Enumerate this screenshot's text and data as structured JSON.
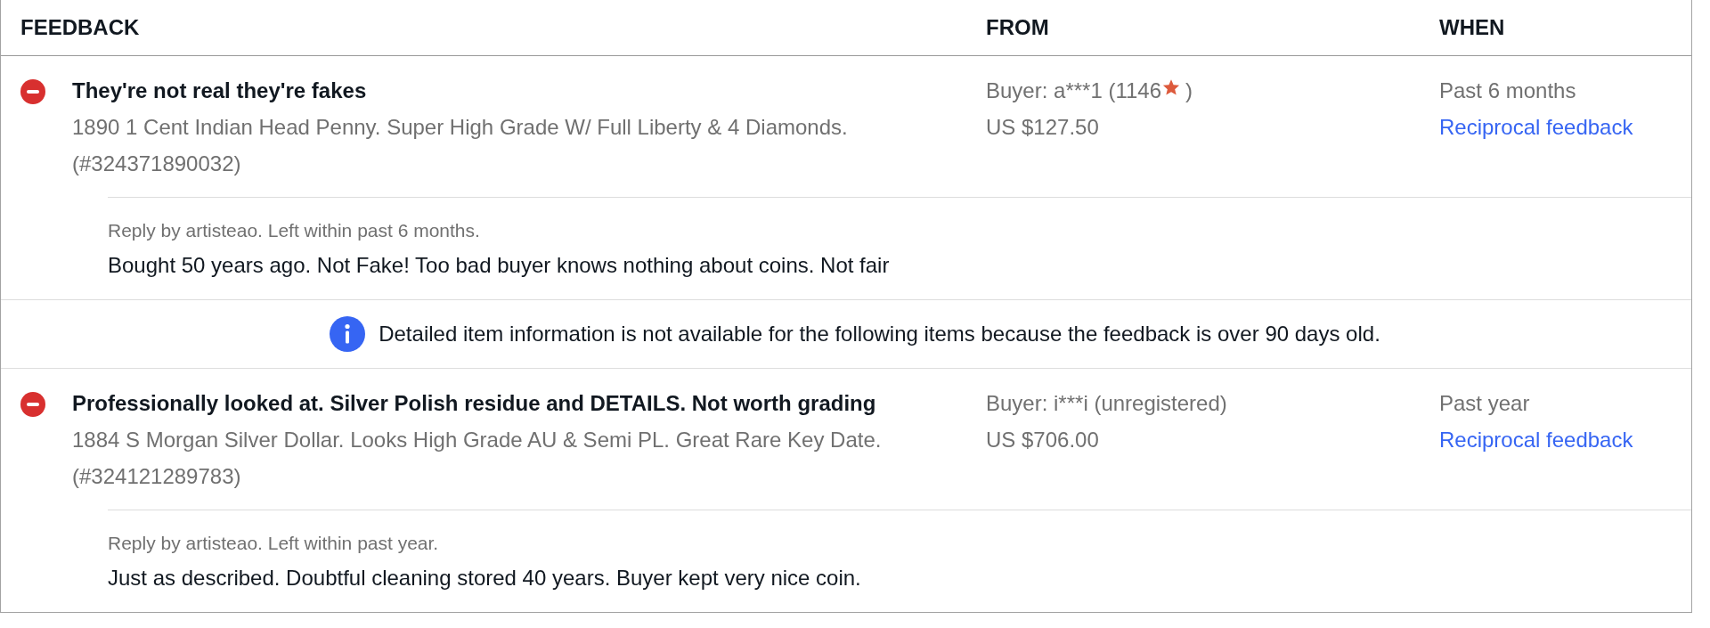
{
  "table": {
    "columns": [
      "FEEDBACK",
      "FROM",
      "WHEN"
    ],
    "rows": [
      {
        "kind": "feedback",
        "negative": true,
        "comment": "They're not real they're fakes",
        "item": "1890 1 Cent Indian Head Penny. Super High Grade W/ Full Liberty & 4 Diamonds. (#324371890032)",
        "buyer": "Buyer: a***1 (1146",
        "star": true,
        "buyer_suffix": ")",
        "price": "US $127.50",
        "when": "Past 6 months",
        "link": "Reciprocal feedback",
        "reply": {
          "meta": "Reply by artisteao. Left within past 6 months.",
          "text": "Bought 50 years ago. Not Fake! Too bad buyer knows nothing about coins. Not fair"
        }
      },
      {
        "kind": "notice",
        "text": "Detailed item information is not available for the following items because the feedback is over 90 days old."
      },
      {
        "kind": "feedback",
        "negative": true,
        "comment": "Professionally looked at. Silver Polish residue and DETAILS. Not worth grading",
        "item": "1884 S Morgan Silver Dollar. Looks High Grade AU & Semi PL. Great Rare Key Date. (#324121289783)",
        "buyer": "Buyer: i***i (unregistered)",
        "star": false,
        "price": "US $706.00",
        "when": "Past year",
        "link": "Reciprocal feedback",
        "reply": {
          "meta": "Reply by artisteao. Left within past year.",
          "text": "Just as described. Doubtful cleaning stored 40 years. Buyer kept very nice coin."
        }
      }
    ]
  }
}
